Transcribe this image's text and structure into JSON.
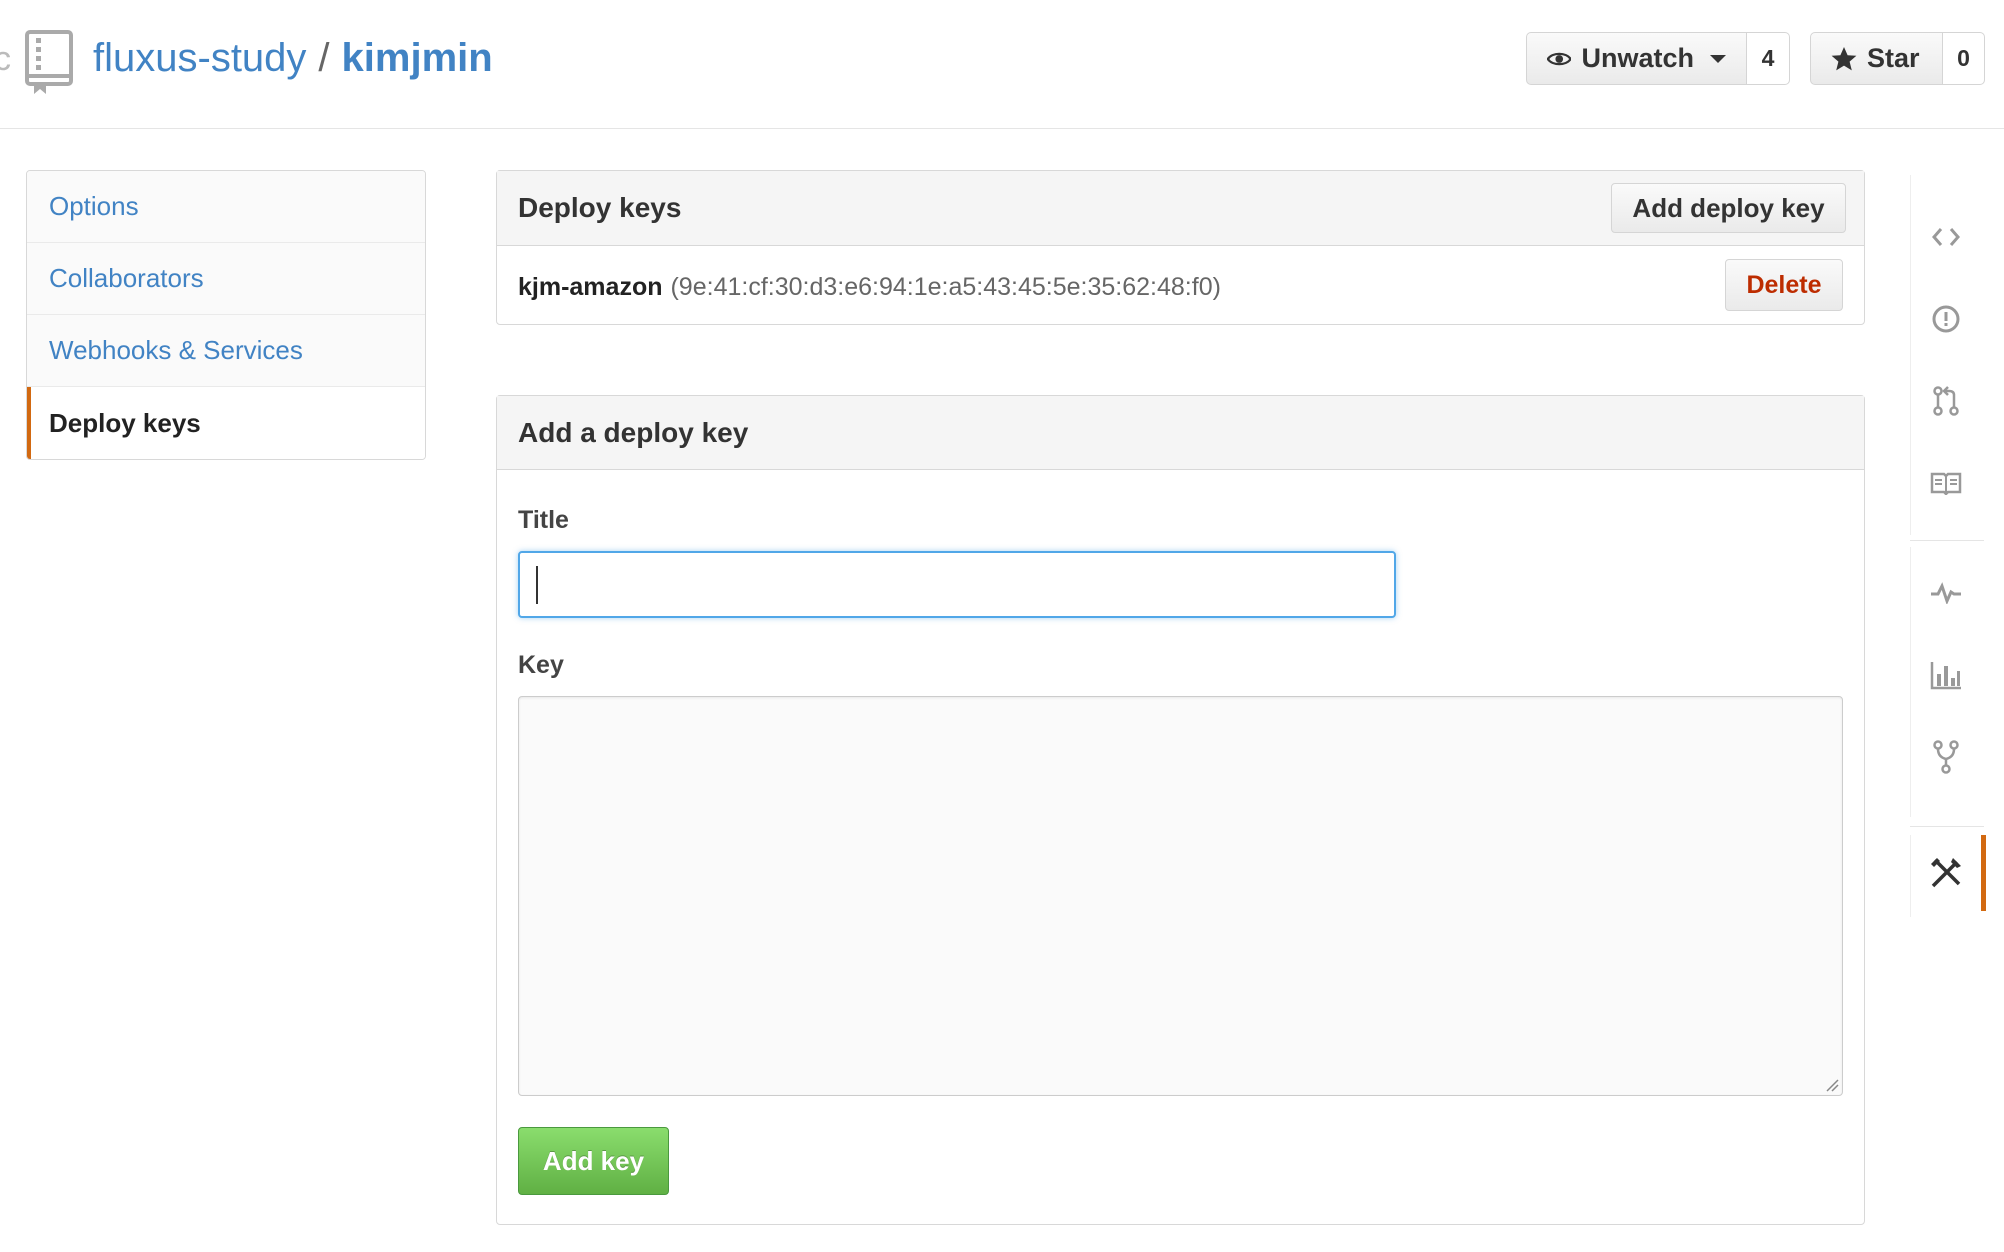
{
  "header": {
    "owner": "fluxus-study",
    "separator": "/",
    "repo": "kimjmin",
    "edge_glyph": "c",
    "watch": {
      "label": "Unwatch",
      "count": "4"
    },
    "star": {
      "label": "Star",
      "count": "0"
    }
  },
  "menu": {
    "items": [
      {
        "label": "Options"
      },
      {
        "label": "Collaborators"
      },
      {
        "label": "Webhooks & Services"
      },
      {
        "label": "Deploy keys",
        "selected": true
      }
    ]
  },
  "deploy_keys": {
    "title": "Deploy keys",
    "add_button": "Add deploy key",
    "keys": [
      {
        "name": "kjm-amazon",
        "fingerprint": "(9e:41:cf:30:d3:e6:94:1e:a5:43:45:5e:35:62:48:f0)",
        "delete_label": "Delete"
      }
    ]
  },
  "add_form": {
    "title": "Add a deploy key",
    "title_label": "Title",
    "title_value": "",
    "key_label": "Key",
    "key_value": "",
    "submit_label": "Add key"
  },
  "right_nav": {
    "icons": [
      "code-icon",
      "issue-icon",
      "pull-request-icon",
      "wiki-icon",
      "pulse-icon",
      "graph-icon",
      "fork-icon",
      "settings-icon"
    ]
  },
  "colors": {
    "link": "#4183c4",
    "accent": "#d26911",
    "danger": "#bd2c00",
    "primary_button": "#60b044",
    "focus": "#51a7e8"
  }
}
